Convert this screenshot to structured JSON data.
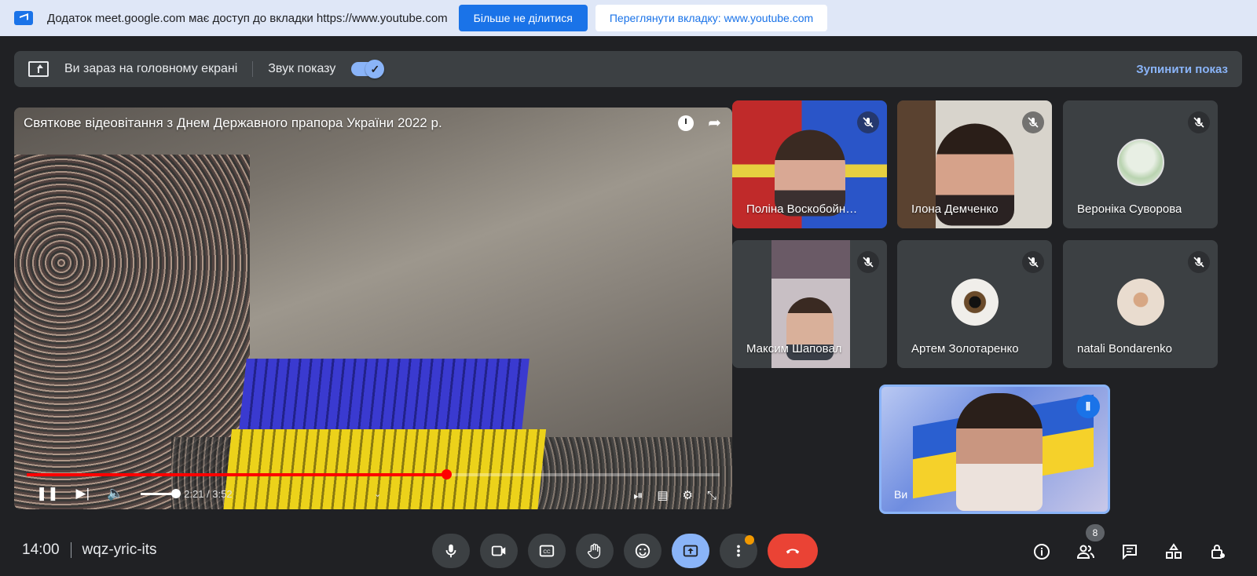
{
  "share_banner": {
    "message": "Додаток meet.google.com має доступ до вкладки https://www.youtube.com",
    "stop_sharing_label": "Більше не ділитися",
    "view_tab_label": "Переглянути вкладку: www.youtube.com"
  },
  "present_bar": {
    "status": "Ви зараз на головному екрані",
    "audio_label": "Звук показу",
    "audio_on": true,
    "stop_label": "Зупинити показ"
  },
  "video": {
    "title": "Святкове відеовітання з Днем Державного прапора України 2022 р.",
    "time": "2:21 / 3:52",
    "progress": 0.606
  },
  "participants": [
    {
      "name": "Поліна Воскобойн…",
      "muted": true
    },
    {
      "name": "Ілона Демченко",
      "muted": true
    },
    {
      "name": "Вероніка Суворова",
      "muted": true
    },
    {
      "name": "Максим Шаповал",
      "muted": true
    },
    {
      "name": "Артем Золотаренко",
      "muted": true
    },
    {
      "name": "natali Bondarenko",
      "muted": true
    }
  ],
  "self_tile": {
    "name": "Ви"
  },
  "bottom_bar": {
    "time": "14:00",
    "meeting_code": "wqz-yric-its",
    "participant_count": "8"
  },
  "colors": {
    "accent": "#8ab4f8",
    "end_call": "#ea4335",
    "banner_bg": "#dfe7f7",
    "youtube_red": "#ff0000"
  }
}
